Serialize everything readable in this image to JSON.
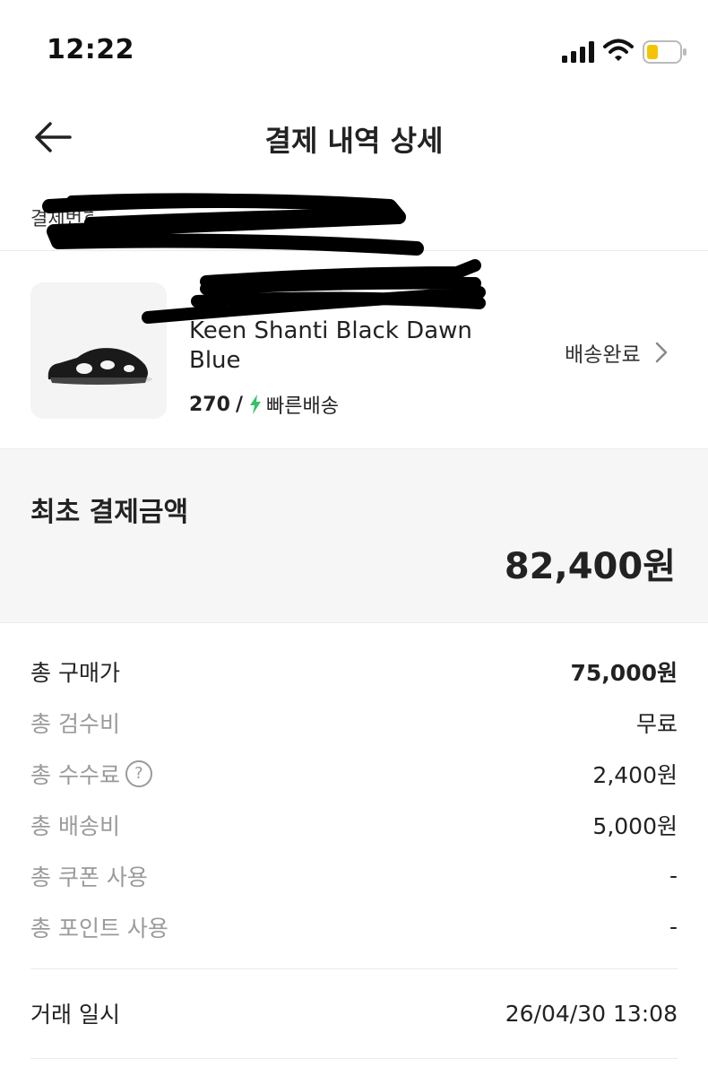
{
  "status_bar": {
    "time": "12:22",
    "battery_color": "#f5c400"
  },
  "header": {
    "title": "결제 내역 상세",
    "back_icon": "arrow-left-icon"
  },
  "payment_number": {
    "label": "결제번호"
  },
  "product": {
    "name": "Keen Shanti Black Dawn Blue",
    "size": "270",
    "separator": "/",
    "shipping_type": "빠른배송",
    "shipping_icon_color": "#36c26b",
    "status": "배송완료"
  },
  "initial_payment": {
    "label": "최초 결제금액",
    "amount": "82,400원"
  },
  "breakdown": [
    {
      "label": "총 구매가",
      "value": "75,000원"
    },
    {
      "label": "총 검수비",
      "value": "무료"
    },
    {
      "label": "총 수수료",
      "value": "2,400원",
      "help_icon": "question-circle-icon"
    },
    {
      "label": "총 배송비",
      "value": "5,000원"
    },
    {
      "label": "총 쿠폰 사용",
      "value": "-"
    },
    {
      "label": "총 포인트 사용",
      "value": "-"
    }
  ],
  "transaction": {
    "label": "거래 일시",
    "value": "26/04/30 13:08"
  }
}
